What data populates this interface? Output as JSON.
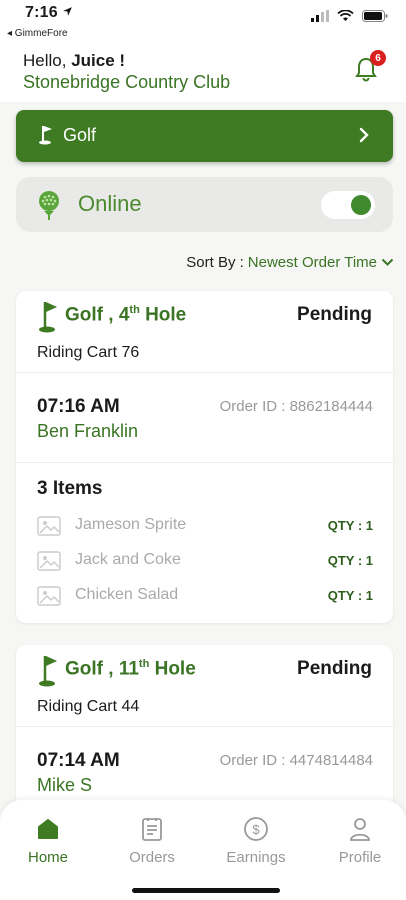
{
  "status_bar": {
    "time": "7:16",
    "back_app": "◂ GimmeFore"
  },
  "header": {
    "greeting_prefix": "Hello, ",
    "user_name": "Juice !",
    "club_name": "Stonebridge Country Club",
    "notification_count": "6"
  },
  "category": {
    "label": "Golf"
  },
  "availability": {
    "label": "Online",
    "enabled": true
  },
  "sort": {
    "label": "Sort By : ",
    "value": "Newest Order Time"
  },
  "orders": [
    {
      "title": "Golf , 4",
      "hole_suffix": "th",
      "title_end": " Hole",
      "status": "Pending",
      "cart": "Riding Cart 76",
      "time": "07:16 AM",
      "order_id": "Order ID : 8862184444",
      "customer": "Ben Franklin",
      "item_count": "3 Items",
      "items": [
        {
          "name": "Jameson Sprite",
          "qty": "QTY : 1"
        },
        {
          "name": "Jack and Coke",
          "qty": "QTY : 1"
        },
        {
          "name": "Chicken Salad",
          "qty": "QTY : 1"
        }
      ]
    },
    {
      "title": "Golf , 11",
      "hole_suffix": "th",
      "title_end": " Hole",
      "status": "Pending",
      "cart": "Riding Cart 44",
      "time": "07:14 AM",
      "order_id": "Order ID : 4474814484",
      "customer": "Mike S"
    }
  ],
  "tabs": [
    {
      "label": "Home",
      "icon": "home-icon",
      "active": true
    },
    {
      "label": "Orders",
      "icon": "orders-icon",
      "active": false
    },
    {
      "label": "Earnings",
      "icon": "dollar-icon",
      "active": false
    },
    {
      "label": "Profile",
      "icon": "profile-icon",
      "active": false
    }
  ],
  "colors": {
    "brand_green": "#3e7b22",
    "text_green": "#3a7424",
    "badge_red": "#d9201f"
  }
}
